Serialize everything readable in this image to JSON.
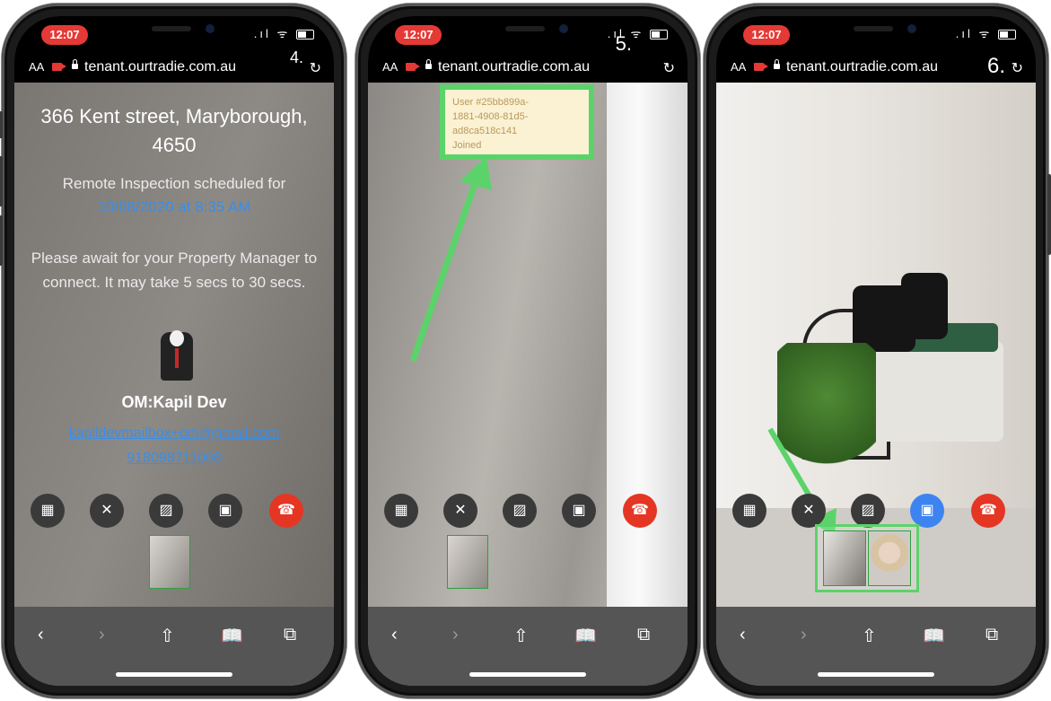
{
  "browser": {
    "time": "12:07",
    "text_size": "AA",
    "url": "tenant.ourtradie.com.au"
  },
  "step_labels": [
    "4.",
    "5.",
    "6."
  ],
  "inspection": {
    "address": "366 Kent street, Maryborough, 4650",
    "schedule_label": "Remote Inspection scheduled for",
    "schedule_datetime": "10/08/2020 at 8:35 AM",
    "await_message": "Please await for your Property Manager to connect. It may take 5 secs to 30 secs.",
    "manager_name": "OM:Kapil Dev",
    "manager_email": "kapildevmailbox+om@gmail.com",
    "manager_phone": "918098711008"
  },
  "toast": {
    "line1": "User #25bb899a-",
    "line2": "1881-4908-81d5-",
    "line3": "ad8ca518c141",
    "line4": "Joined"
  },
  "controls": [
    {
      "name": "grid-icon",
      "glyph": "▦"
    },
    {
      "name": "mic-off-icon",
      "glyph": "🎙"
    },
    {
      "name": "video-off-icon",
      "glyph": "▨"
    },
    {
      "name": "camera-switch-icon",
      "glyph": "▣"
    },
    {
      "name": "end-call-icon",
      "glyph": "☎"
    }
  ],
  "toolbar_icons": [
    "back-icon",
    "forward-icon",
    "share-icon",
    "bookmarks-icon",
    "tabs-icon"
  ],
  "colors": {
    "time_pill": "#e53935",
    "end_call": "#e53624",
    "active_camera": "#3d84f0",
    "link": "#3a8ee8",
    "highlight": "#5cd36a"
  }
}
